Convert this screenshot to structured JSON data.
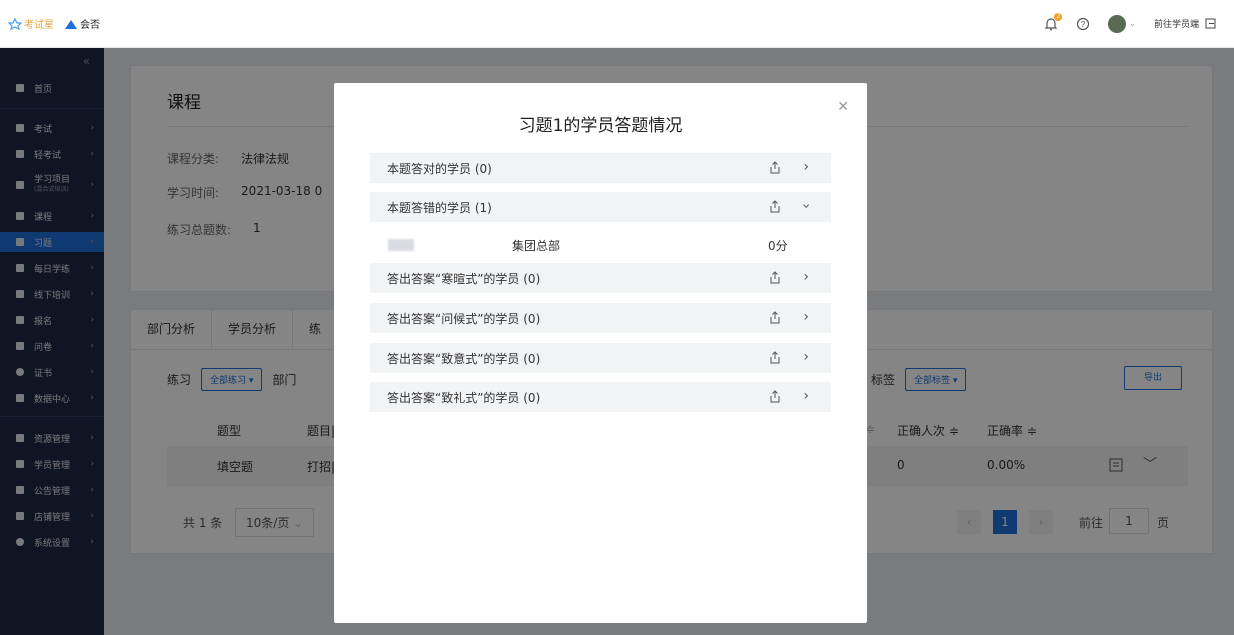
{
  "topbar": {
    "logo_primary": "考试星",
    "logo_secondary": "会否",
    "notification_count": "2",
    "goto_student_label": "前往学员端"
  },
  "sidebar": {
    "items": [
      {
        "label": "首页"
      },
      {
        "label": "考试"
      },
      {
        "label": "轻考试"
      },
      {
        "label": "学习项目",
        "sub": "(混合式培训)"
      },
      {
        "label": "课程"
      },
      {
        "label": "习题"
      },
      {
        "label": "每日学练"
      },
      {
        "label": "线下培训"
      },
      {
        "label": "报名"
      },
      {
        "label": "问卷"
      },
      {
        "label": "证书"
      },
      {
        "label": "数据中心"
      },
      {
        "label": "资源管理"
      },
      {
        "label": "学员管理"
      },
      {
        "label": "公告管理"
      },
      {
        "label": "店铺管理"
      },
      {
        "label": "系统设置"
      }
    ]
  },
  "course": {
    "title": "课程",
    "category_label": "课程分类:",
    "category_value": "法律法规",
    "time_label": "学习时间:",
    "time_value": "2021-03-18 0",
    "total_label": "练习总题数:",
    "total_value": "1"
  },
  "analysis": {
    "tabs": [
      "部门分析",
      "学员分析",
      "练"
    ],
    "practice_label": "练习",
    "practice_select": "全部练习 ▾",
    "dept_label": "部门",
    "tag_label": "标签",
    "tag_select": "全部标签 ▾",
    "export_label": "导出",
    "columns": {
      "type": "题型",
      "stem": "题目|",
      "correct_count": "正确人次 ≑",
      "correct_rate": "正确率 ≑",
      "sort_mark": "≑"
    },
    "row": {
      "type": "填空题",
      "stem": "打招|",
      "correct_count": "0",
      "correct_rate": "0.00%"
    },
    "pager": {
      "total": "共 1 条",
      "page_size": "10条/页",
      "current_page": "1",
      "goto_label": "前往",
      "goto_value": "1",
      "page_unit": "页"
    }
  },
  "modal": {
    "title": "习题1的学员答题情况",
    "groups": [
      {
        "label": "本题答对的学员 (0)"
      },
      {
        "label": "本题答错的学员 (1)",
        "expanded": true
      },
      {
        "label": "答出答案“寒暄式”的学员 (0)"
      },
      {
        "label": "答出答案“问候式”的学员 (0)"
      },
      {
        "label": "答出答案“致意式”的学员 (0)"
      },
      {
        "label": "答出答案“致礼式”的学员 (0)"
      }
    ],
    "detail": {
      "department": "集团总部",
      "score": "0分"
    }
  },
  "colors": {
    "accent": "#1e6fd9",
    "sidebar_bg": "#1f2a44"
  }
}
